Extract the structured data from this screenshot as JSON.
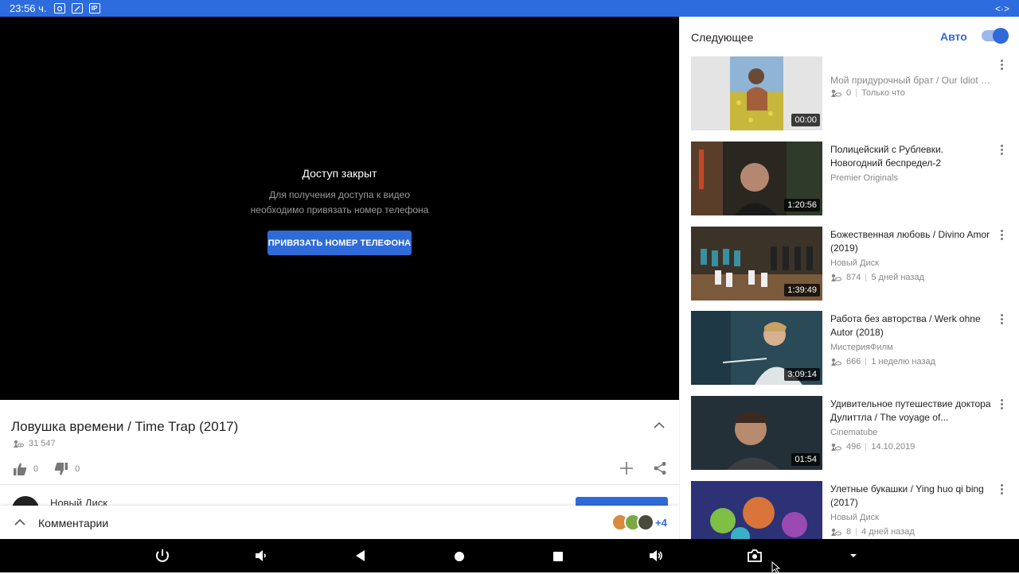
{
  "status_bar": {
    "time": "23:56 ч.",
    "icons": [
      "screenshot-icon",
      "edit-icon",
      "ip-icon"
    ],
    "ip_label": "IP",
    "right_icon": "<·>"
  },
  "player": {
    "locked_title": "Доступ закрыт",
    "locked_desc_line1": "Для получения доступа к видео",
    "locked_desc_line2": "необходимо привязать номер телефона",
    "bind_button": "ПРИВЯЗАТЬ НОМЕР ТЕЛЕФОНА"
  },
  "video": {
    "title": "Ловушка времени / Time Trap (2017)",
    "views": "31 547",
    "likes": "0",
    "dislikes": "0",
    "channel": "Новый Диск"
  },
  "comments": {
    "label": "Комментарии",
    "extra_count": "+4"
  },
  "sidebar": {
    "header": "Следующее",
    "auto_label": "Авто",
    "auto_enabled": true,
    "items": [
      {
        "title": "Мой придурочный брат / Our Idiot Brot...",
        "channel": "",
        "views": "0",
        "date": "Только что",
        "duration": "00:00"
      },
      {
        "title": "Полицейский с Рублевки. Новогодний беспредел-2",
        "channel": "Premier Originals",
        "views": "",
        "date": "",
        "duration": "1:20:56"
      },
      {
        "title": "Божественная любовь / Divino Amor (2019)",
        "channel": "Новый Диск",
        "views": "874",
        "date": "5 дней назад",
        "duration": "1:39:49"
      },
      {
        "title": "Работа без авторства / Werk ohne Autor (2018)",
        "channel": "МистерияФилм",
        "views": "666",
        "date": "1 неделю назад",
        "duration": "3:09:14"
      },
      {
        "title": "Удивительное путешествие доктора Дулиттла / The voyage of...",
        "channel": "Cinematube",
        "views": "496",
        "date": "14.10.2019",
        "duration": "01:54"
      },
      {
        "title": "Улетные букашки / Ying huo qi bing (2017)",
        "channel": "Новый Диск",
        "views": "8",
        "date": "4 дней назад",
        "duration": ""
      }
    ]
  },
  "colors": {
    "accent": "#2f6ad9",
    "status_bar": "#2d6cdf",
    "player_bg": "#000000"
  }
}
